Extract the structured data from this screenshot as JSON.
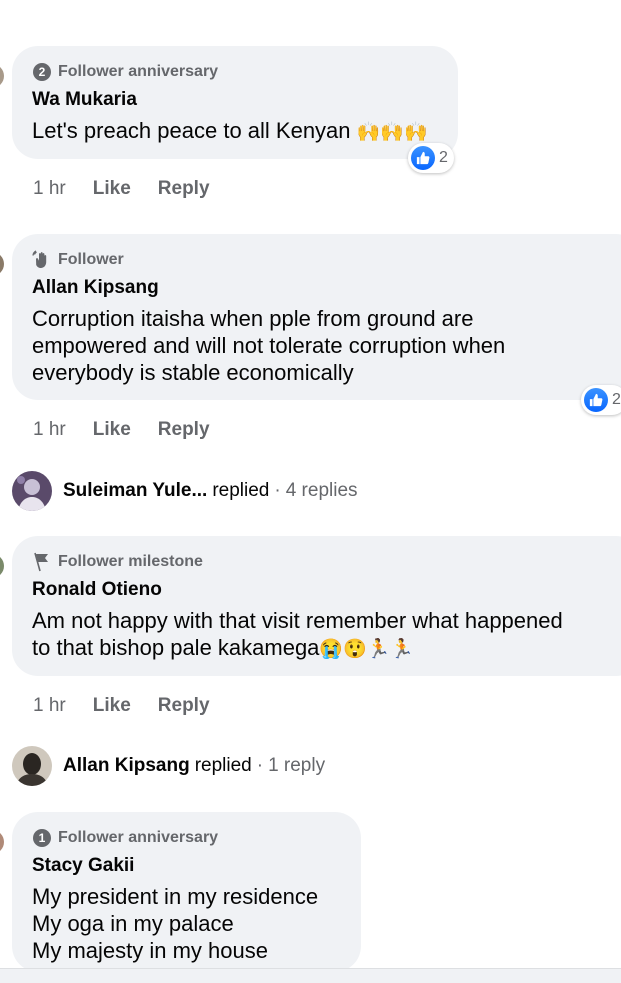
{
  "comments": [
    {
      "badge": "Follower anniversary",
      "badge_number": "2",
      "author": "Wa Mukaria",
      "text": "Let's preach peace to all Kenyan",
      "emoji": "🙌🙌🙌",
      "reaction_count": "2",
      "time": "1 hr",
      "like_label": "Like",
      "reply_label": "Reply"
    },
    {
      "badge": "Follower",
      "author": "Allan Kipsang",
      "text": "Corruption itaisha when pple from ground are\nempowered and will not tolerate corruption when\neverybody is stable economically",
      "reaction_count": "2",
      "time": "1 hr",
      "like_label": "Like",
      "reply_label": "Reply"
    },
    {
      "badge": "Follower milestone",
      "author": "Ronald Otieno",
      "text_line1": "Am not happy with that visit remember what happened",
      "text_line2": "to that bishop pale kakamega",
      "emoji": "😭😲🏃🏃",
      "time": "1 hr",
      "like_label": "Like",
      "reply_label": "Reply"
    },
    {
      "badge": "Follower anniversary",
      "badge_number": "1",
      "author": "Stacy Gakii",
      "text": "My president in my residence\nMy oga in my palace\nMy majesty in my house"
    }
  ],
  "reply_threads": [
    {
      "name": "Suleiman Yule...",
      "action": "replied",
      "separator": "·",
      "count": "4 replies"
    },
    {
      "name": "Allan Kipsang",
      "action": "replied",
      "separator": "·",
      "count": "1 reply"
    }
  ],
  "colors": {
    "bubble": "#f0f2f5",
    "secondary_text": "#65676b",
    "like_blue": "#0866ff"
  },
  "icons": {
    "anniversary": "numbered-circle-icon",
    "follower": "waving-hand-icon",
    "milestone": "flag-icon",
    "reaction": "thumbs-up-icon"
  }
}
